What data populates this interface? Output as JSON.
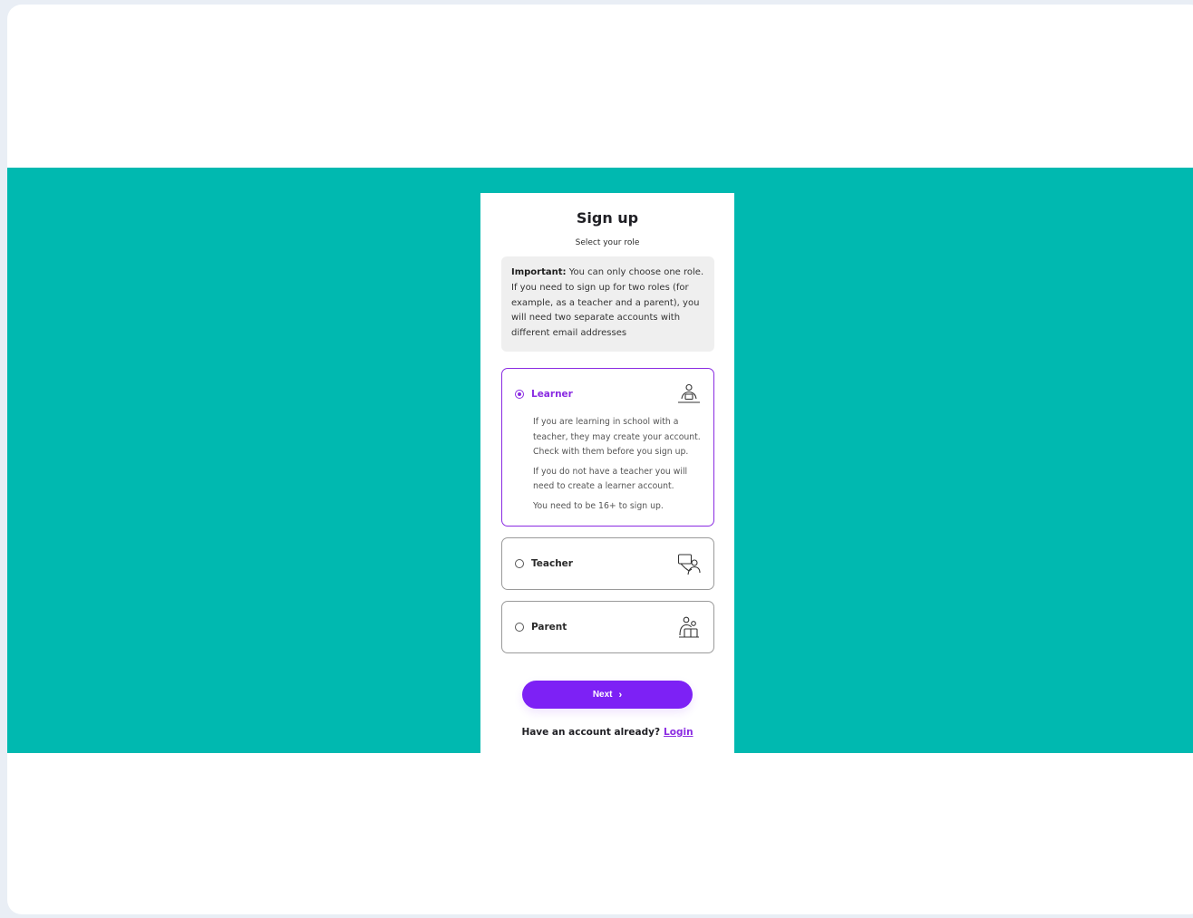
{
  "page": {
    "title": "Sign up",
    "subtitle": "Select your role",
    "notice_bold": "Important:",
    "notice_text": " You can only choose one role. If you need to sign up for two roles (for example, as a teacher and a parent), you will need two separate accounts with different email addresses"
  },
  "roles": [
    {
      "label": "Learner",
      "selected": true,
      "icon": "learner-laptop-icon",
      "description": [
        "If you are learning in school with a teacher, they may create your account. Check with them before you sign up.",
        "If you do not have a teacher you will need to create a learner account.",
        "You need to be 16+ to sign up."
      ]
    },
    {
      "label": "Teacher",
      "selected": false,
      "icon": "teacher-board-icon"
    },
    {
      "label": "Parent",
      "selected": false,
      "icon": "parent-child-icon"
    }
  ],
  "actions": {
    "next_label": "Next",
    "next_icon": "chevron-right-icon",
    "account_text": "Have an account already?",
    "login_label": "Login"
  },
  "colors": {
    "teal": "#00b9b0",
    "accent": "#8a2be2",
    "button": "#7d21f5"
  }
}
